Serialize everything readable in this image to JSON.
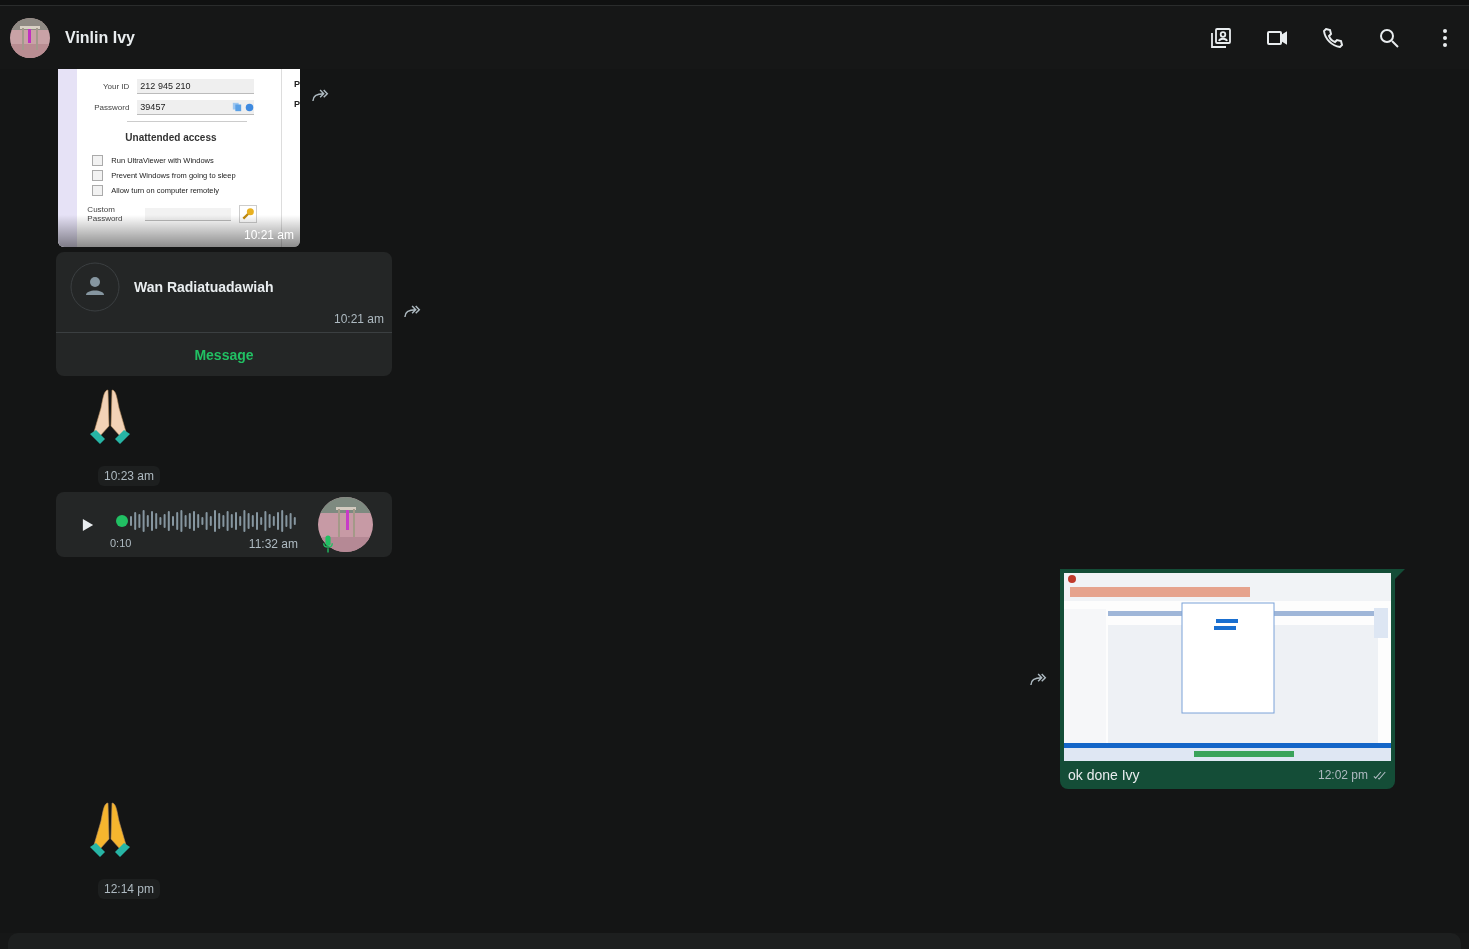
{
  "header": {
    "name": "Vinlin Ivy"
  },
  "messages": [
    {
      "kind": "incoming_image",
      "time": "10:21 am",
      "forward": true,
      "screenshot": {
        "your_id_label": "Your ID",
        "your_id": "212 945 210",
        "password_label": "Password",
        "password": "39457",
        "side_labels": [
          "P",
          "P"
        ],
        "section_title": "Unattended access",
        "options": [
          {
            "label": "Run UltraViewer with Windows",
            "checked": false
          },
          {
            "label": "Prevent Windows from going to sleep",
            "checked": false
          },
          {
            "label": "Allow turn on computer remotely",
            "checked": false
          }
        ],
        "custom_password_label": "Custom Password"
      }
    },
    {
      "kind": "contact",
      "name": "Wan Radiatuadawiah",
      "time": "10:21 am",
      "action": "Message",
      "forward": true
    },
    {
      "kind": "emoji",
      "color": "#f2d2b6",
      "time": "10:23 am"
    },
    {
      "kind": "voice",
      "duration": "0:10",
      "time": "11:32 am"
    },
    {
      "kind": "outgoing_image",
      "caption": "ok done Ivy",
      "time": "12:02 pm",
      "read": true,
      "forward": true
    },
    {
      "kind": "emoji",
      "color": "#f5b52e",
      "time": "12:14 pm"
    }
  ]
}
